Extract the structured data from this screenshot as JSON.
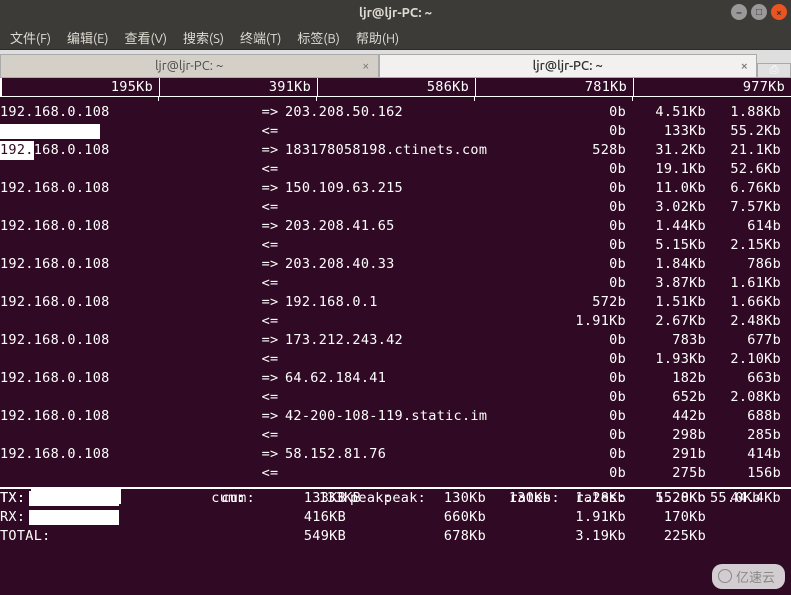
{
  "window": {
    "title": "ljr@ljr-PC: ~"
  },
  "menu": {
    "items": [
      "文件(F)",
      "编辑(E)",
      "查看(V)",
      "搜索(S)",
      "终端(T)",
      "标签(B)",
      "帮助(H)"
    ]
  },
  "tabs": [
    {
      "label": "ljr@ljr-PC: ~",
      "active": false
    },
    {
      "label": "ljr@ljr-PC: ~",
      "active": true
    }
  ],
  "scale": [
    "195Kb",
    "391Kb",
    "586Kb",
    "781Kb",
    "977Kb"
  ],
  "connections": [
    {
      "src": "192.168.0.108",
      "dst": "203.208.50.162",
      "out": [
        "0b",
        "4.51Kb",
        "1.88Kb"
      ],
      "in": [
        "0b",
        "133Kb",
        "55.2Kb"
      ]
    },
    {
      "src": "192.168.0.108",
      "hl": true,
      "dst": "183178058198.ctinets.com",
      "out": [
        "528b",
        "31.2Kb",
        "21.1Kb"
      ],
      "in": [
        "0b",
        "19.1Kb",
        "52.6Kb"
      ]
    },
    {
      "src": "192.168.0.108",
      "dst": "150.109.63.215",
      "out": [
        "0b",
        "11.0Kb",
        "6.76Kb"
      ],
      "in": [
        "0b",
        "3.02Kb",
        "7.57Kb"
      ]
    },
    {
      "src": "192.168.0.108",
      "dst": "203.208.41.65",
      "out": [
        "0b",
        "1.44Kb",
        "614b"
      ],
      "in": [
        "0b",
        "5.15Kb",
        "2.15Kb"
      ]
    },
    {
      "src": "192.168.0.108",
      "dst": "203.208.40.33",
      "out": [
        "0b",
        "1.84Kb",
        "786b"
      ],
      "in": [
        "0b",
        "3.87Kb",
        "1.61Kb"
      ]
    },
    {
      "src": "192.168.0.108",
      "dst": "192.168.0.1",
      "out": [
        "572b",
        "1.51Kb",
        "1.66Kb"
      ],
      "in": [
        "1.91Kb",
        "2.67Kb",
        "2.48Kb"
      ]
    },
    {
      "src": "192.168.0.108",
      "dst": "173.212.243.42",
      "out": [
        "0b",
        "783b",
        "677b"
      ],
      "in": [
        "0b",
        "1.93Kb",
        "2.10Kb"
      ]
    },
    {
      "src": "192.168.0.108",
      "dst": "64.62.184.41",
      "out": [
        "0b",
        "182b",
        "663b"
      ],
      "in": [
        "0b",
        "652b",
        "2.08Kb"
      ]
    },
    {
      "src": "192.168.0.108",
      "dst": "42-200-108-119.static.im",
      "out": [
        "0b",
        "442b",
        "688b"
      ],
      "in": [
        "0b",
        "298b",
        "285b"
      ]
    },
    {
      "src": "192.168.0.108",
      "dst": "58.152.81.76",
      "out": [
        "0b",
        "291b",
        "414b"
      ],
      "in": [
        "0b",
        "275b",
        "156b"
      ]
    }
  ],
  "arrows": {
    "out": "=>",
    "in": "<="
  },
  "summary": {
    "cum_label": "cum:",
    "peak_label": "peak:",
    "rates_label": "rates:",
    "tx": {
      "label": "TX:",
      "cum": "133KB",
      "peak": "130Kb",
      "r1": "1.28Kb",
      "r2": "55.0Kb",
      "r3": "44.4Kb"
    },
    "rx": {
      "label": "RX:",
      "cum": "416KB",
      "peak": "660Kb",
      "r1": "1.91Kb",
      "r2": "170Kb",
      "r3": ""
    },
    "total": {
      "label": "TOTAL:",
      "cum": "549KB",
      "peak": "678Kb",
      "r1": "3.19Kb",
      "r2": "225Kb",
      "r3": ""
    }
  },
  "watermark": "亿速云"
}
